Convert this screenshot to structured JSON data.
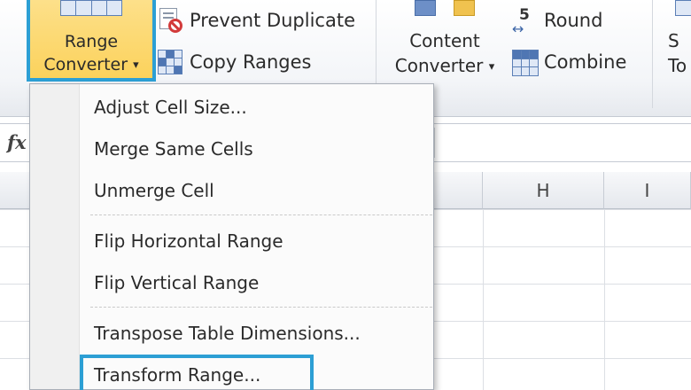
{
  "ribbon": {
    "range_converter": {
      "line1": "Range",
      "line2": "Converter",
      "arrow": "▾"
    },
    "prevent_duplicate": "Prevent Duplicate",
    "copy_ranges": "Copy Ranges",
    "content_converter": {
      "line1": "Content",
      "line2": "Converter",
      "arrow": "▾"
    },
    "round": "Round",
    "combine": "Combine",
    "partial_next": {
      "line1": "S",
      "line2": "To"
    }
  },
  "formula_bar": {
    "fx_label": "fx"
  },
  "columns": [
    "H",
    "I"
  ],
  "menu": {
    "items": [
      "Adjust Cell Size...",
      "Merge Same Cells",
      "Unmerge Cell",
      "Flip Horizontal Range",
      "Flip Vertical Range",
      "Transpose Table Dimensions...",
      "Transform Range..."
    ],
    "highlighted": "Transform Range..."
  },
  "colors": {
    "highlight_border": "#2c9fd4",
    "button_active": "#fbd25c"
  }
}
